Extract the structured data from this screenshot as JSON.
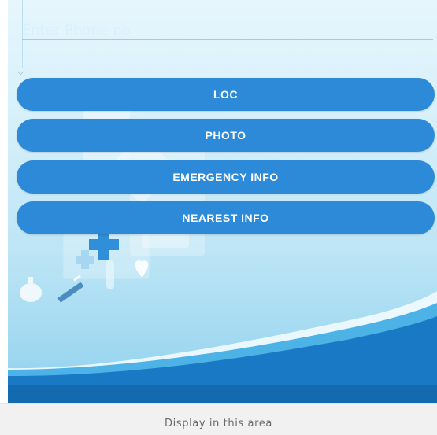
{
  "form": {
    "phone_placeholder": "Enter Phone no",
    "phone_value": ""
  },
  "buttons": {
    "loc": "LOC",
    "photo": "PHOTO",
    "emergency": "EMERGENCY INFO",
    "nearest": "NEAREST INFO"
  },
  "display": {
    "text": "Display in this area"
  },
  "colors": {
    "button": "#2c8ad8",
    "background_top": "#e6f6fc",
    "wave": "#1565a8"
  }
}
